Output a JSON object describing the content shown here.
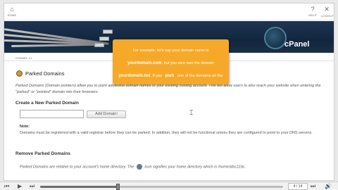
{
  "topnav": {
    "home_label": "HOME",
    "help_label": "HELP",
    "logout_label": "LOGOUT"
  },
  "banner": {
    "brand": "cPanel"
  },
  "breadcrumb": "CPANEL 11",
  "page": {
    "title": "Parked Domains",
    "description": "Parked Domains (Domain pointers) allow you to point additional domain names to your existing hosting account. This will allow users to also reach your website when entering the \"parked\" or \"pointed\" domain into their browsers.",
    "create_heading": "Create a New Parked Domain",
    "add_button": "Add Domain!",
    "note_label": "Note:",
    "note_text": "Domains must be registered with a valid registrar before they can be parked. In addition, they will not be functional unless they are configured to point to your DNS servers.",
    "remove_heading": "Remove Parked Domains",
    "remove_text_a": "Parked Domains are relative to your account's home directory. The",
    "remove_text_b": "icon signifies your home directory which is /home/abc123c."
  },
  "callout": {
    "t1": "For example, let's say your domain name is",
    "b1": "yourdomain.com",
    "t2": ", but you also own the domain",
    "b2": "yourdomain.net",
    "t3": ". If you",
    "b3": "park",
    "t4": "one of the domains on the other, then both will result in visitors getting to your website."
  },
  "player": {
    "counter": "4 / 14",
    "progress": 0.32
  }
}
